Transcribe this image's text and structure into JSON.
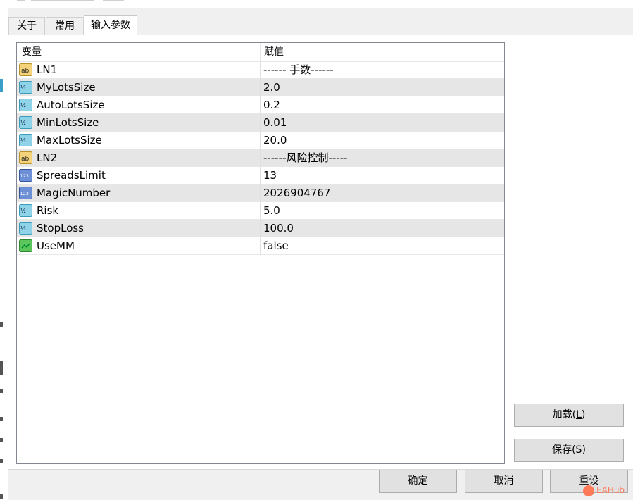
{
  "tabs": [
    {
      "label": "关于"
    },
    {
      "label": "常用"
    },
    {
      "label": "输入参数"
    }
  ],
  "grid": {
    "headers": {
      "name": "变量",
      "value": "赋值"
    },
    "rows": [
      {
        "icon": "string-icon",
        "name": "LN1",
        "value": "------ 手数------"
      },
      {
        "icon": "double-icon",
        "name": "MyLotsSize",
        "value": "2.0"
      },
      {
        "icon": "double-icon",
        "name": "AutoLotsSize",
        "value": "0.2"
      },
      {
        "icon": "double-icon",
        "name": "MinLotsSize",
        "value": "0.01"
      },
      {
        "icon": "double-icon",
        "name": "MaxLotsSize",
        "value": "20.0"
      },
      {
        "icon": "string-icon",
        "name": "LN2",
        "value": "------风险控制-----"
      },
      {
        "icon": "integer-icon",
        "name": "SpreadsLimit",
        "value": "13"
      },
      {
        "icon": "integer-icon",
        "name": "MagicNumber",
        "value": "2026904767"
      },
      {
        "icon": "double-icon",
        "name": "Risk",
        "value": "5.0"
      },
      {
        "icon": "double-icon",
        "name": "StopLoss",
        "value": "100.0"
      },
      {
        "icon": "bool-icon",
        "name": "UseMM",
        "value": "false"
      }
    ]
  },
  "side_buttons": {
    "load": {
      "label": "加载(",
      "key": "L",
      "suffix": ")"
    },
    "save": {
      "label": "保存(",
      "key": "S",
      "suffix": ")"
    }
  },
  "footer_buttons": {
    "ok": "确定",
    "cancel": "取消",
    "reset": "重设"
  },
  "watermark": "EAHub",
  "colors": {
    "string_icon": "#f4d37a",
    "double_icon": "#8fd3e8",
    "integer_icon": "#6c8fd6",
    "bool_icon": "#5cc55c",
    "row_alt": "#e6e6e6"
  }
}
